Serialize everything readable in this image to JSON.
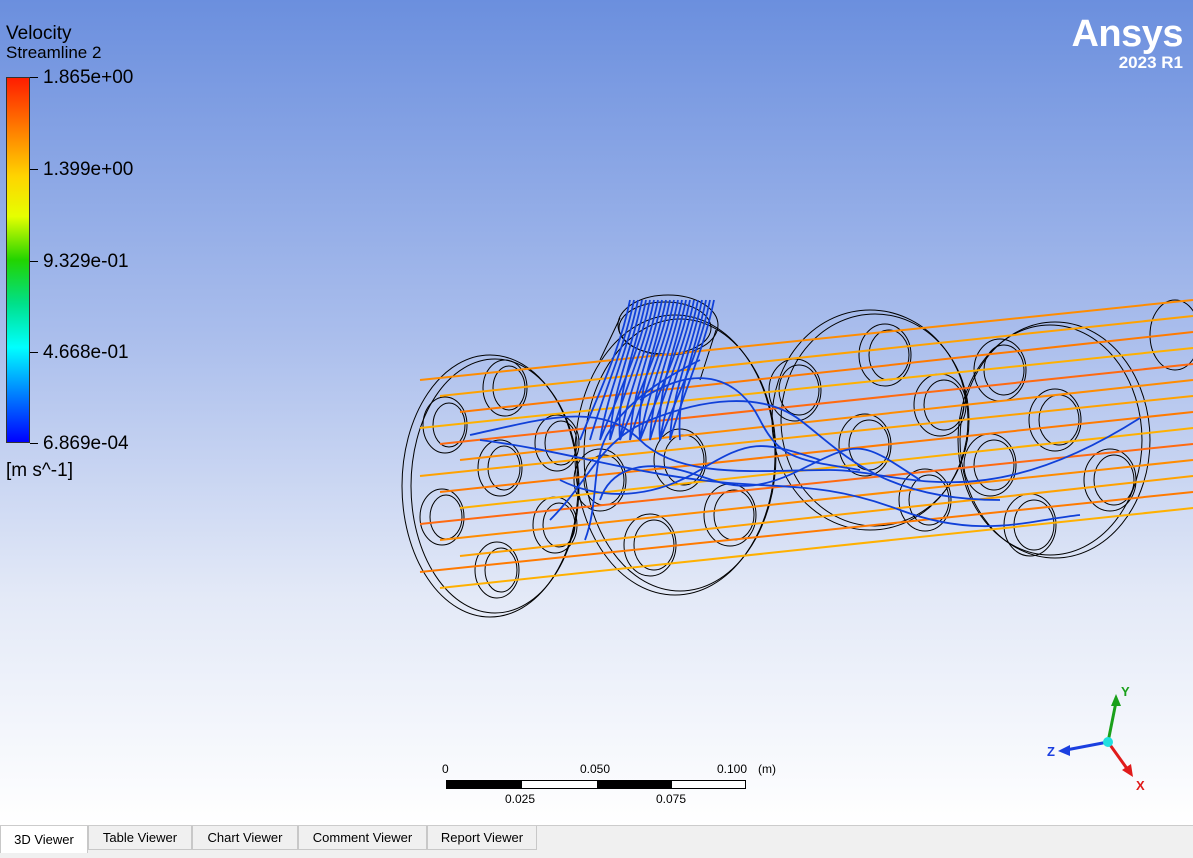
{
  "legend": {
    "title": "Velocity",
    "subtitle": "Streamline 2",
    "values": [
      "1.865e+00",
      "1.399e+00",
      "9.329e-01",
      "4.668e-01",
      "6.869e-04"
    ],
    "unit": "[m s^-1]"
  },
  "logo": {
    "name": "Ansys",
    "version": "2023 R1"
  },
  "scale": {
    "top_labels": [
      "0",
      "0.050",
      "0.100",
      "(m)"
    ],
    "bottom_labels": [
      "0.025",
      "0.075"
    ]
  },
  "axes": {
    "y": "Y",
    "z": "Z",
    "x": "X"
  },
  "tabs": [
    "3D Viewer",
    "Table Viewer",
    "Chart Viewer",
    "Comment Viewer",
    "Report Viewer"
  ],
  "active_tab": "3D Viewer",
  "colors": {
    "streamline_fast": "#ff8c00",
    "streamline_slow": "#0a3fd6",
    "geometry_edges": "#000000"
  }
}
